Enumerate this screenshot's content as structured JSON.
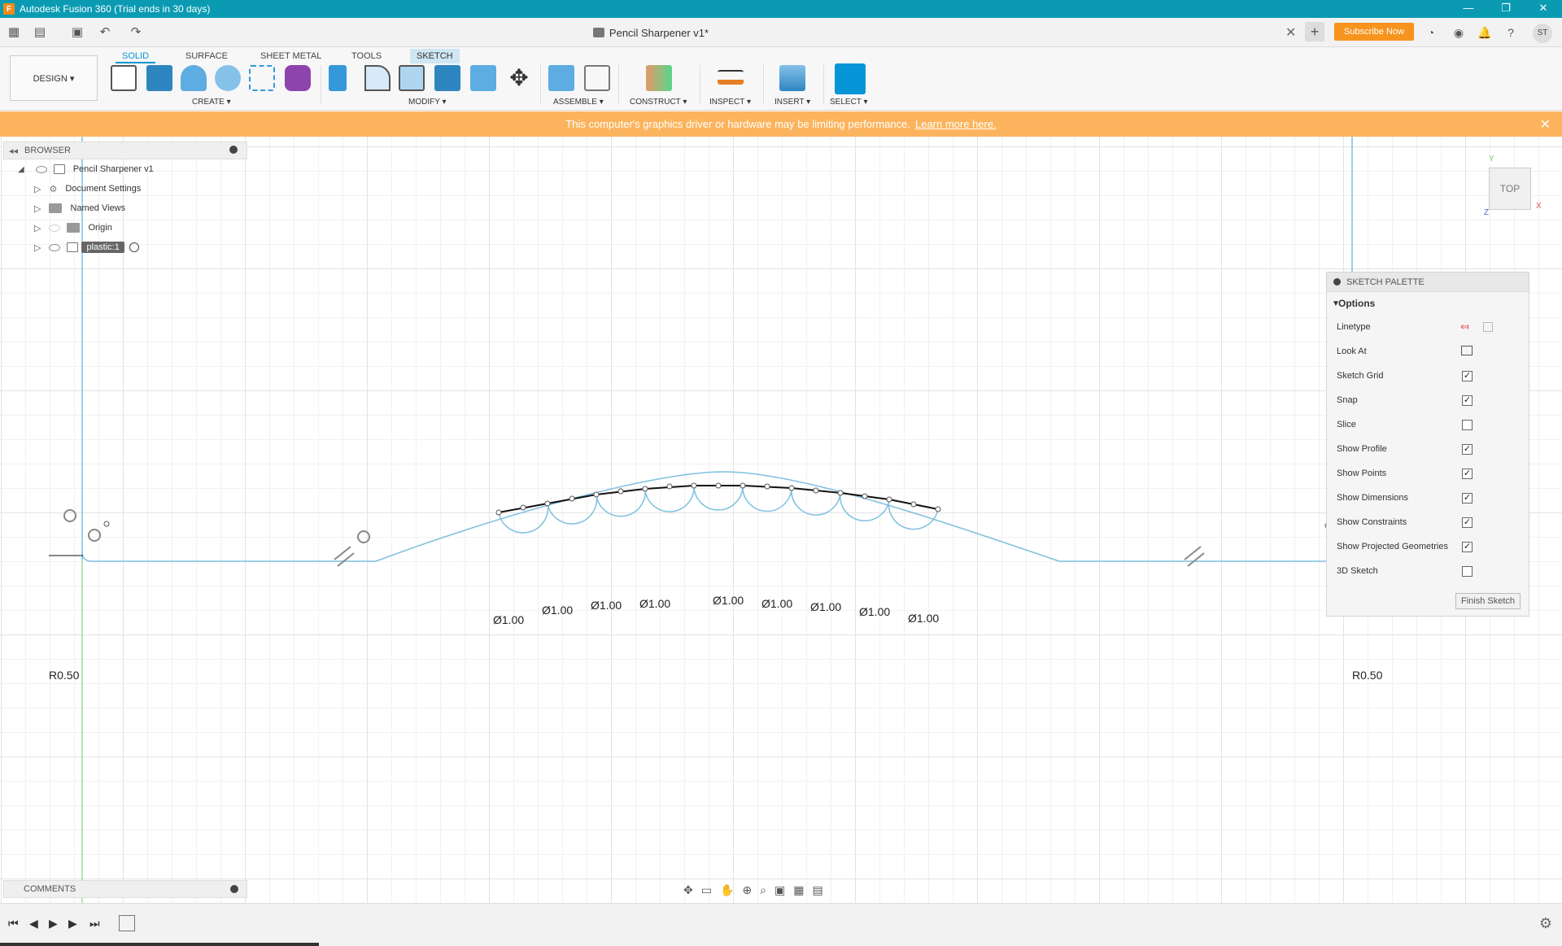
{
  "window": {
    "title": "Autodesk Fusion 360 (Trial ends in 30 days)",
    "minimize": "—",
    "restore": "❐",
    "close": "✕"
  },
  "document": {
    "title": "Pencil Sharpener v1*",
    "subscribe_label": "Subscribe Now",
    "user_initials": "ST"
  },
  "ribbon": {
    "tabs": [
      "SOLID",
      "SURFACE",
      "SHEET METAL",
      "TOOLS",
      "SKETCH"
    ],
    "workspace": "DESIGN ▾",
    "groups": [
      "CREATE ▾",
      "MODIFY ▾",
      "ASSEMBLE ▾",
      "CONSTRUCT ▾",
      "INSPECT ▾",
      "INSERT ▾",
      "SELECT ▾"
    ]
  },
  "warning": {
    "text": "This computer's graphics driver or hardware may be limiting performance.",
    "link": "Learn more here."
  },
  "browser": {
    "title": "BROWSER",
    "items": [
      "Pencil Sharpener v1",
      "Document Settings",
      "Named Views",
      "Origin",
      "plastic:1"
    ]
  },
  "comments": {
    "title": "COMMENTS"
  },
  "palette": {
    "title": "SKETCH PALETTE",
    "section": "Options",
    "options": [
      {
        "label": "Linetype",
        "kind": "icons"
      },
      {
        "label": "Look At",
        "kind": "icon"
      },
      {
        "label": "Sketch Grid",
        "checked": true
      },
      {
        "label": "Snap",
        "checked": true
      },
      {
        "label": "Slice",
        "checked": false
      },
      {
        "label": "Show Profile",
        "checked": true
      },
      {
        "label": "Show Points",
        "checked": true
      },
      {
        "label": "Show Dimensions",
        "checked": true
      },
      {
        "label": "Show Constraints",
        "checked": true
      },
      {
        "label": "Show Projected Geometries",
        "checked": true
      },
      {
        "label": "3D Sketch",
        "checked": false
      }
    ],
    "finish_label": "Finish Sketch"
  },
  "viewcube": {
    "face": "TOP",
    "x": "X",
    "y": "Y",
    "z": "Z"
  },
  "sketch": {
    "dimension_label": "Ø1.00",
    "radius_left": "R0.50",
    "radius_right": "R0.50"
  },
  "colors": {
    "title_bar": "#0a9bb3",
    "warning": "#fbb45d",
    "sketch_line": "#7ec0e0",
    "accent": "#0696d7"
  }
}
